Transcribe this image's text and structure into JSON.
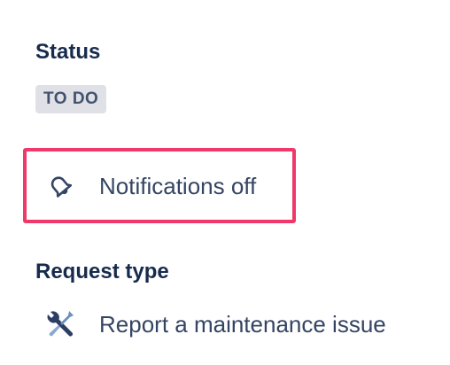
{
  "status": {
    "heading": "Status",
    "value": "TO DO"
  },
  "notifications": {
    "label": "Notifications off",
    "icon": "bell-off-icon",
    "highlight_color": "#f0386b"
  },
  "request_type": {
    "heading": "Request type",
    "value": "Report a maintenance issue",
    "icon": "tools-icon"
  }
}
